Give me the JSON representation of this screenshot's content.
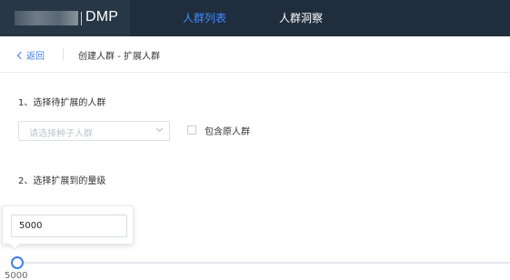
{
  "brand": {
    "name": "DMP"
  },
  "nav": {
    "items": [
      {
        "label": "人群列表",
        "active": true
      },
      {
        "label": "人群洞察",
        "active": false
      }
    ]
  },
  "breadcrumb": {
    "back_label": "返回",
    "title": "创建人群 - 扩展人群"
  },
  "step1": {
    "label": "1、选择待扩展的人群",
    "select_placeholder": "请选择种子人群",
    "checkbox_label": "包含原人群",
    "checkbox_checked": false
  },
  "step2": {
    "label": "2、选择扩展到的量级",
    "input_value": "5000",
    "slider_value": "5000"
  },
  "colors": {
    "nav_bg": "#1f2d3d",
    "accent": "#3f7df0",
    "active_nav": "#3f8cff"
  }
}
